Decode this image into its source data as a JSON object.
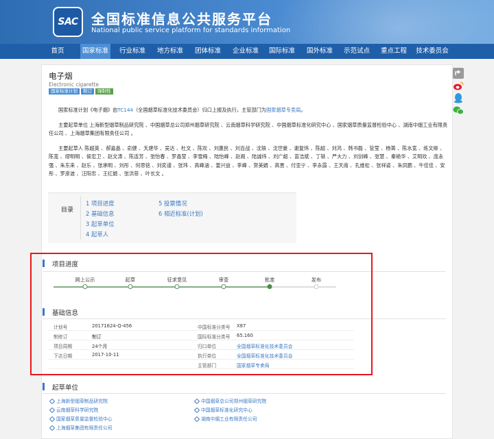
{
  "site": {
    "logo_text": "SAC",
    "title": "全国标准信息公共服务平台",
    "subtitle": "National public service platform  for standards information"
  },
  "nav": {
    "items": [
      "首页",
      "国家标准",
      "行业标准",
      "地方标准",
      "团体标准",
      "企业标准",
      "国际标准",
      "国外标准",
      "示范试点",
      "重点工程",
      "技术委员会"
    ],
    "active_index": 1
  },
  "standard": {
    "title": "电子烟",
    "title_en": "Electronic cigarette",
    "tags": [
      {
        "label": "国家标准计划",
        "color": "#4a8fd4"
      },
      {
        "label": "制订",
        "color": "#4a8fd4"
      },
      {
        "label": "强制性",
        "color": "#5aa04a"
      }
    ]
  },
  "intro": {
    "p1_prefix": "国家标准计划《电子烟》由",
    "p1_tc": "TC144",
    "p1_mid": "（全国烟草标准化技术委员会）归口上报及执行，主管部门为",
    "p1_dept": "国家烟草专卖局",
    "p1_suffix": "。",
    "p2": "主要起草单位 上海新型烟草制品研究院 、中国烟草总公司郑州烟草研究院 、云南烟草科学研究院 、中国烟草标准化研究中心 、国家烟草质量监督检验中心 、湖南中烟工业有限责任公司 、上海烟草集团有限责任公司 。",
    "p3": "主要起草人 陈超英 、郝嘉晶 、俞健 、夭建华 、吴达 、杜文 、陈欢 、刘惠民 、刘百战 、沈轶 、沈世豪 、谢复炜 、陈超 、刘鸿 、韩书磊 、管莹 、杨菁 、陈水宽 、练文柳 、陈宽 、缪明明 、侯宏卫 、赵文涛 、陈连芳 、张怡春 、罗晶莹 、李雪梅 、陆怡峰 、赵阁 、陆诚纬 、刘广超 、苗洁斌 、丁轶 、严大力 、刘剑峰 、张慧 、秦艳华 、艾明欢 、庞永强 、朱东来 、赵乐 、张承明 、刘彤 、何思铭 、刘奕谨 、张玮 、高峰涵 、姜兴益 、李峰 、贺美娟 、高晋 、付亚宁 、李永霞 、王天南 、孔维松 、张祥姿 、朱凤鹏 、牛佳佳 、安彤 、罗彦波 、汪阳忠 、王红娟 、张洪菲 、叶长文 。"
  },
  "toc": {
    "label": "目录",
    "items": [
      "1  项目进度",
      "2  基础信息",
      "3  起草单位",
      "4  起草人",
      "5  投票情况",
      "6  相近标准(计划)"
    ]
  },
  "progress": {
    "title": "项目进度",
    "steps": [
      {
        "label": "网上公示",
        "state": "done"
      },
      {
        "label": "起草",
        "state": "done"
      },
      {
        "label": "征求意见",
        "state": "done"
      },
      {
        "label": "审查",
        "state": "done"
      },
      {
        "label": "批准",
        "state": "current"
      },
      {
        "label": "发布",
        "state": "pending"
      }
    ]
  },
  "basic": {
    "title": "基础信息",
    "rows": [
      {
        "k1": "计划号",
        "v1": "20171624-Q-456",
        "k2": "中国标准分类号",
        "v2": "X87",
        "v2_link": false
      },
      {
        "k1": "制修订",
        "v1": "制订",
        "k2": "国际标准分类号",
        "v2": "65.160",
        "v2_link": false
      },
      {
        "k1": "项目周期",
        "v1": "24个月",
        "k2": "归口单位",
        "v2": "全国烟草标准化技术委员会",
        "v2_link": true
      },
      {
        "k1": "下达日期",
        "v1": "2017-10-11",
        "k2": "执行单位",
        "v2": "全国烟草标准化技术委员会",
        "v2_link": true
      },
      {
        "k1": "",
        "v1": "",
        "k2": "主管部门",
        "v2": "国家烟草专卖局",
        "v2_link": true
      }
    ]
  },
  "drafters": {
    "title": "起草单位",
    "items": [
      "上海新型烟草制品研究院",
      "中国烟草总公司郑州烟草研究院",
      "云南烟草科学研究院",
      "中国烟草标准化研究中心",
      "国家烟草质量监督检验中心",
      "湖南中烟工业有限责任公司",
      "上海烟草集团有限责任公司"
    ]
  },
  "share": {
    "icons": [
      "share-icon",
      "weibo-icon",
      "qq-icon",
      "wechat-icon"
    ]
  }
}
